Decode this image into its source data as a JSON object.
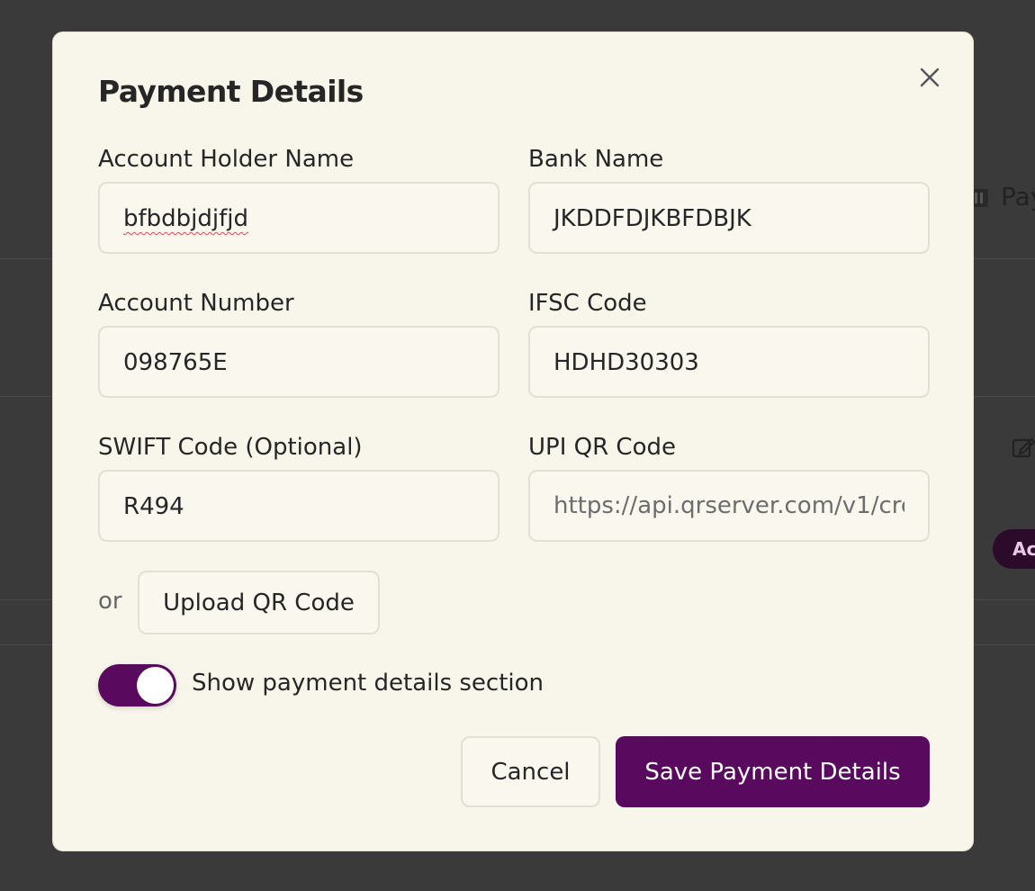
{
  "background": {
    "partial_text": "Pay",
    "badge_partial": "Ac"
  },
  "modal": {
    "title": "Payment Details",
    "fields": {
      "account_holder_name": {
        "label": "Account Holder Name",
        "value": "bfbdbjdjfjd"
      },
      "bank_name": {
        "label": "Bank Name",
        "value": "JKDDFDJKBFDBJK"
      },
      "account_number": {
        "label": "Account Number",
        "value": "098765E"
      },
      "ifsc_code": {
        "label": "IFSC Code",
        "value": "HDHD30303"
      },
      "swift_code": {
        "label": "SWIFT Code (Optional)",
        "value": "R494"
      },
      "upi_qr_code": {
        "label": "UPI QR Code",
        "placeholder": "https://api.qrserver.com/v1/cre"
      }
    },
    "or_text": "or",
    "upload_label": "Upload QR Code",
    "toggle": {
      "label": "Show payment details section",
      "on": true
    },
    "cancel_label": "Cancel",
    "save_label": "Save Payment Details"
  },
  "colors": {
    "accent": "#5a0a5e",
    "modal_bg": "#f8f6ea",
    "overlay": "#3a3a3a"
  }
}
